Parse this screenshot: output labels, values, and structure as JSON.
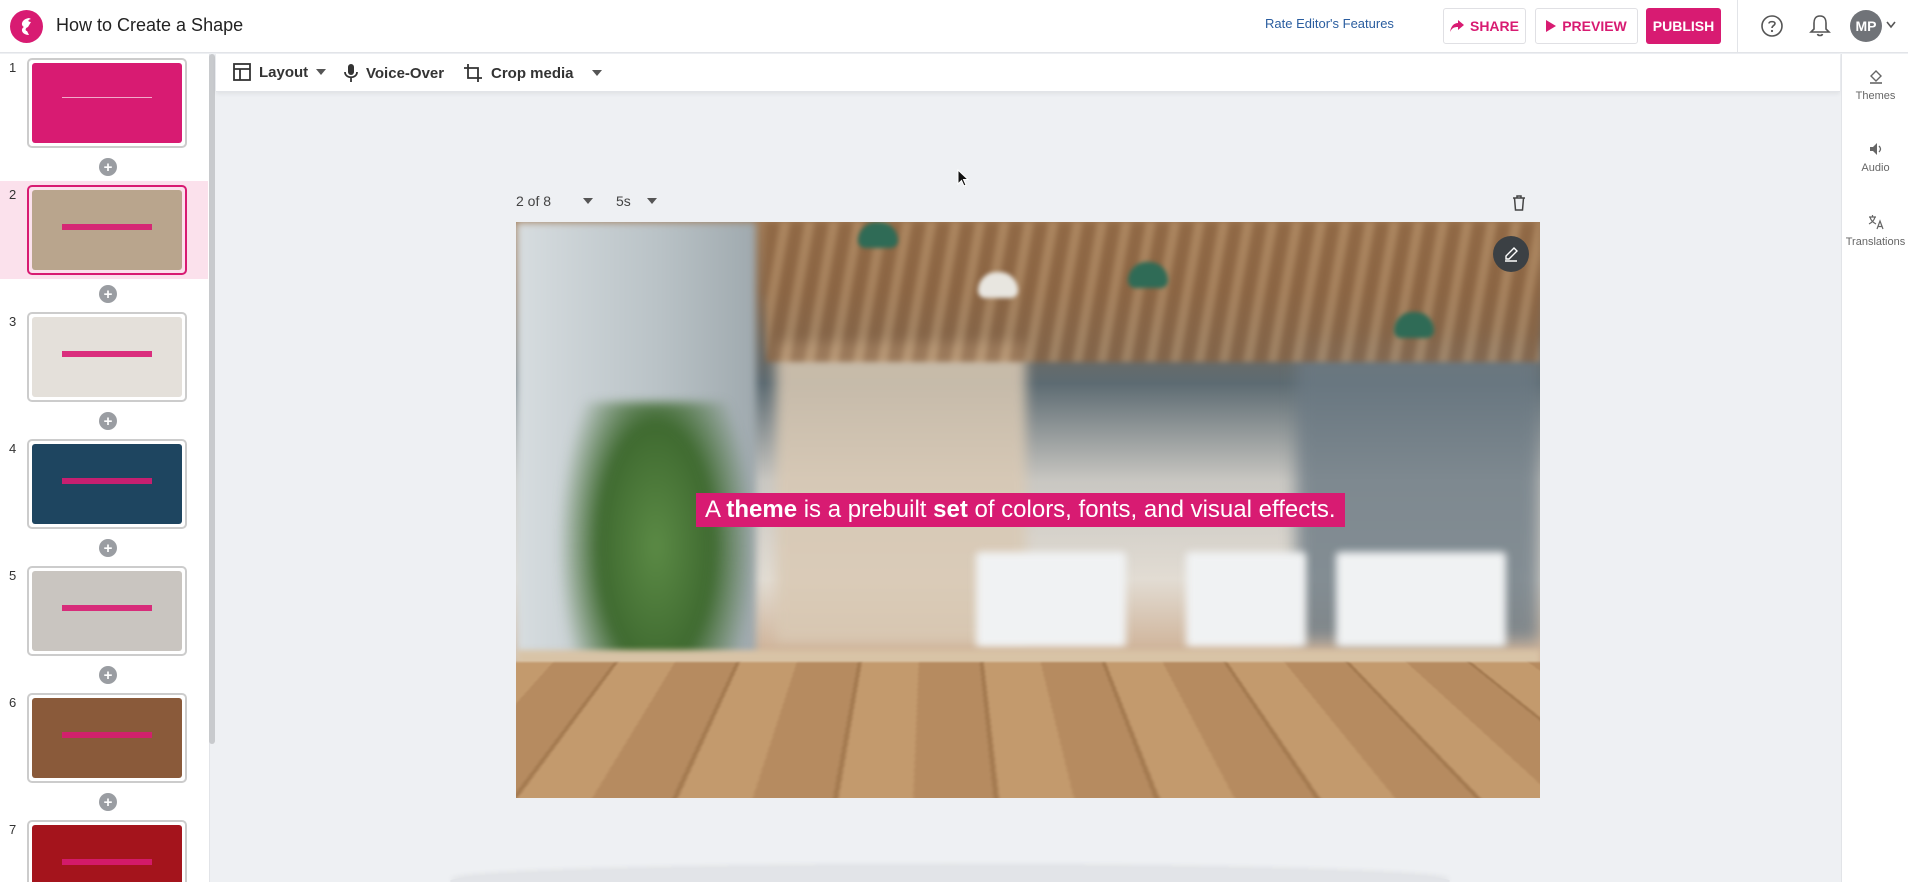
{
  "app": {
    "title": "How to Create a Shape",
    "rate_link": "Rate Editor's Features",
    "share_label": "SHARE",
    "preview_label": "PREVIEW",
    "publish_label": "PUBLISH",
    "avatar_initials": "MP",
    "accent": "#d81b72"
  },
  "toolbar": {
    "layout_label": "Layout",
    "voiceover_label": "Voice-Over",
    "crop_label": "Crop media"
  },
  "right_panel": {
    "themes_label": "Themes",
    "audio_label": "Audio",
    "translations_label": "Translations"
  },
  "filmstrip": {
    "slides": [
      {
        "num": "1",
        "bg": "#d81b72"
      },
      {
        "num": "2",
        "bg": "#b9a58d"
      },
      {
        "num": "3",
        "bg": "#e4e0da"
      },
      {
        "num": "4",
        "bg": "#1e4560"
      },
      {
        "num": "5",
        "bg": "#c9c5c0"
      },
      {
        "num": "6",
        "bg": "#8a5a3a"
      },
      {
        "num": "7",
        "bg": "#a4141c"
      }
    ],
    "selected": "2"
  },
  "slide": {
    "position": "2 of 8",
    "duration": "5s",
    "caption": {
      "t1": "A ",
      "b1": "theme",
      "t2": " is a prebuilt ",
      "b2": "set",
      "t3": " of colors, fonts, and visual effects."
    }
  }
}
